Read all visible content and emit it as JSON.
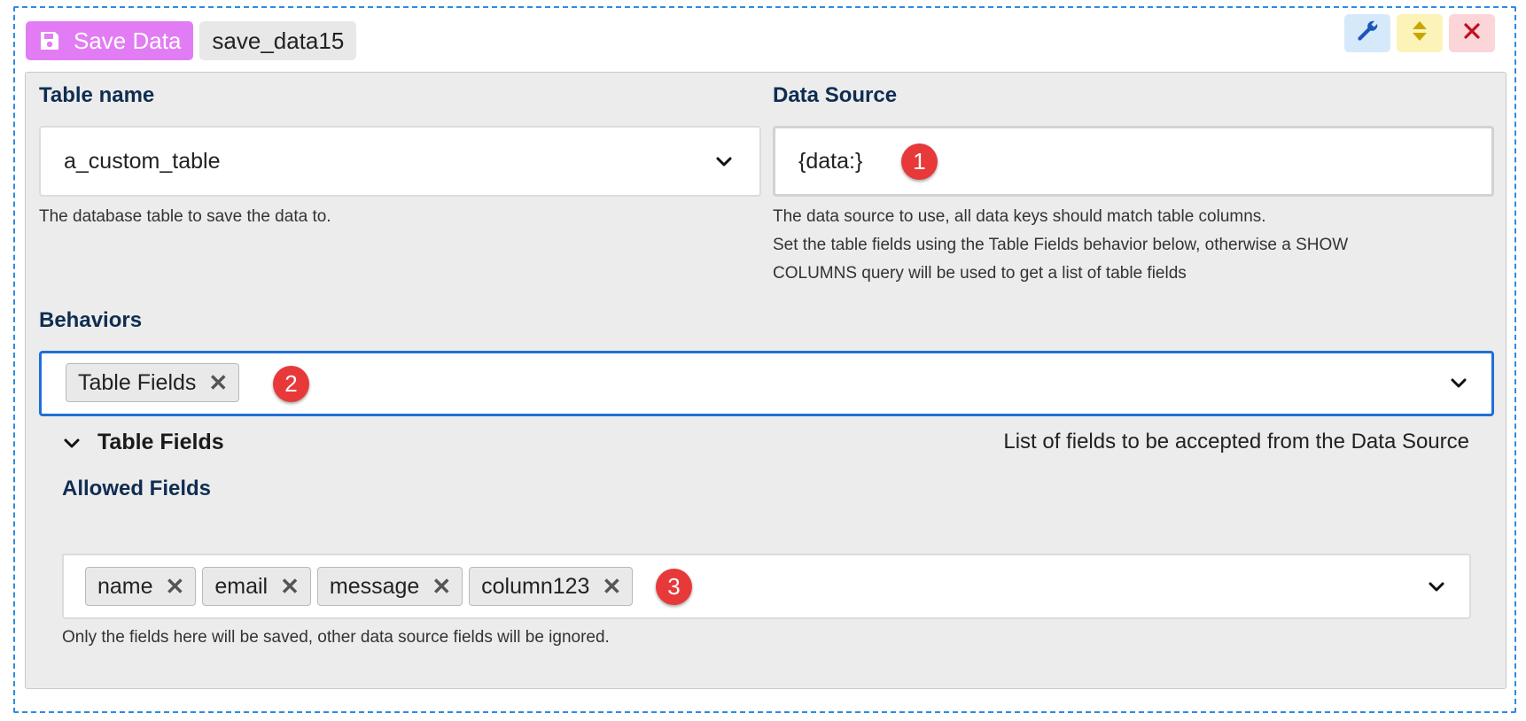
{
  "header": {
    "save_label": "Save Data",
    "block_id": "save_data15"
  },
  "toolbar": {
    "settings_icon": "wrench-icon",
    "move_icon": "sort-icon",
    "close_icon": "close-icon",
    "colors": {
      "settings": "#d6e9fb",
      "move": "#fbf3b8",
      "close": "#fbd5d8"
    }
  },
  "table_name": {
    "label": "Table name",
    "value": "a_custom_table",
    "help": "The database table to save the data to."
  },
  "data_source": {
    "label": "Data Source",
    "value": "{data:}",
    "help_lines": [
      "The data source to use, all data keys should match table columns.",
      "Set the table fields using the Table Fields behavior below, otherwise a SHOW",
      "COLUMNS query will be used to get a list of table fields"
    ]
  },
  "behaviors": {
    "label": "Behaviors",
    "chips": [
      "Table Fields"
    ]
  },
  "table_fields": {
    "title": "Table Fields",
    "description": "List of fields to be accepted from the Data Source",
    "allowed_label": "Allowed Fields",
    "chips": [
      "name",
      "email",
      "message",
      "column123"
    ],
    "help": "Only the fields here will be saved, other data source fields will be ignored."
  },
  "annotations": [
    "1",
    "2",
    "3"
  ],
  "colors": {
    "save_button": "#e27cf4",
    "focus_border": "#1f6fd6",
    "label": "#0f2d52",
    "badge": "#e8393a"
  }
}
